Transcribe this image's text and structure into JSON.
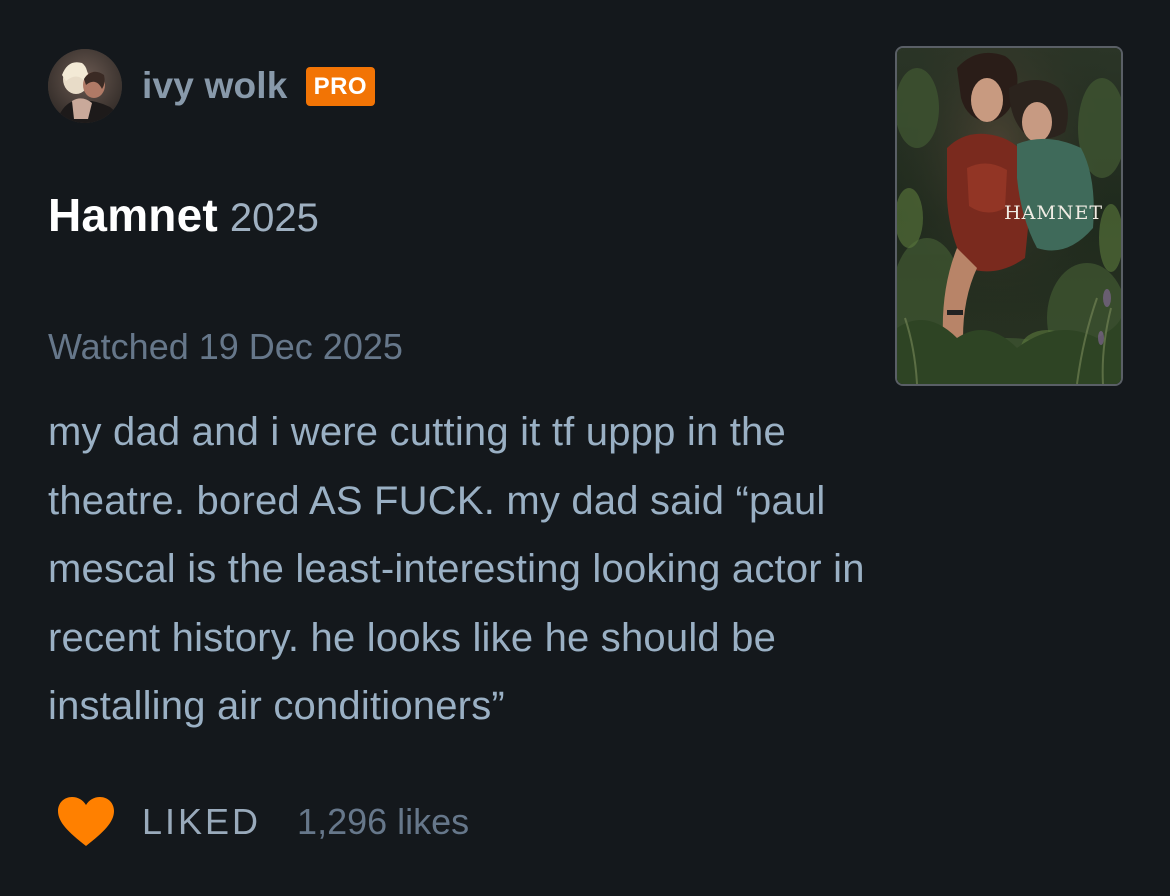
{
  "user": {
    "name": "ivy wolk",
    "badge": "PRO"
  },
  "film": {
    "title": "Hamnet",
    "year": "2025",
    "poster_title": "HAMNET"
  },
  "diary": {
    "watched": "Watched 19 Dec 2025"
  },
  "review": {
    "text": "my dad and i were cutting it tf uppp in the\ntheatre. bored AS FUCK. my dad said “paul\nmescal is the least-interesting looking actor in\nrecent history. he looks like he should be\ninstalling air conditioners”"
  },
  "footer": {
    "liked_label": "LIKED",
    "likes_count": "1,296 likes"
  },
  "icons": {
    "heart": "heart-icon",
    "avatar": "avatar"
  },
  "colors": {
    "background": "#14181c",
    "accent_orange": "#f27405",
    "heart": "#ff8000",
    "text_muted": "#66778a",
    "text_body": "#9ab0c4"
  }
}
